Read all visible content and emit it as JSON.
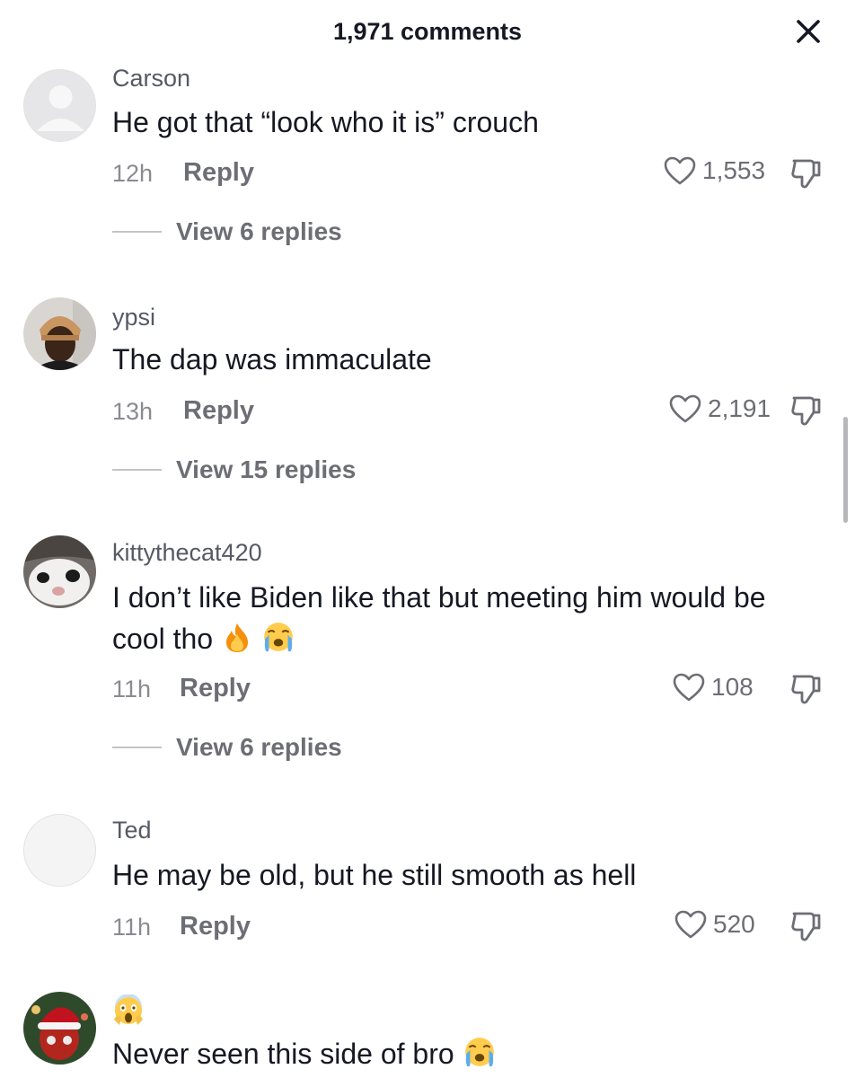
{
  "header": {
    "title": "1,971 comments"
  },
  "reply_label": "Reply",
  "comments": [
    {
      "username": "Carson",
      "text": "He got that “look who it is” crouch",
      "time": "12h",
      "likes": "1,553",
      "view_replies": "View 6 replies"
    },
    {
      "username": "ypsi",
      "text": "The dap was immaculate",
      "time": "13h",
      "likes": "2,191",
      "view_replies": "View 15 replies"
    },
    {
      "username": "kittythecat420",
      "text": "I don’t like Biden like that but meeting him would be cool tho",
      "emojis": [
        "fire-emoji",
        "loudly-crying-emoji"
      ],
      "time": "11h",
      "likes": "108",
      "view_replies": "View 6 replies"
    },
    {
      "username": "Ted",
      "text": "He may be old, but he still smooth as hell",
      "time": "11h",
      "likes": "520"
    },
    {
      "username_emoji": "face-screaming-in-fear-emoji",
      "text": "Never seen this side of bro",
      "emojis": [
        "loudly-crying-emoji"
      ]
    }
  ],
  "colors": {
    "text": "#161823",
    "secondary": "#6d6e75",
    "muted": "#8a8b91"
  }
}
